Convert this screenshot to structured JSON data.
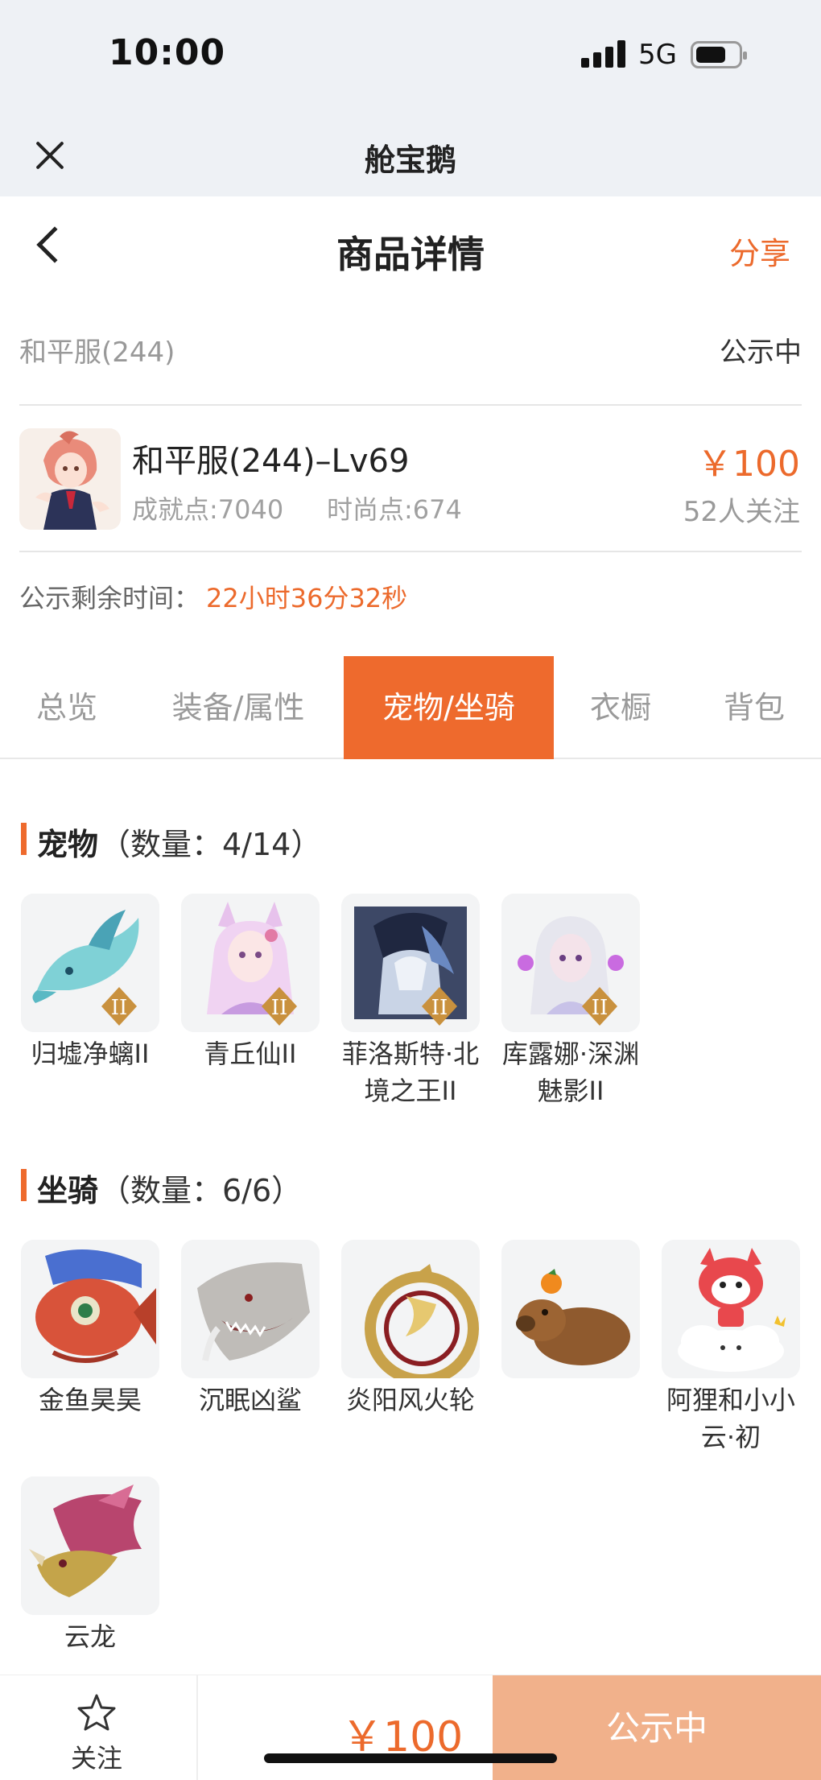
{
  "status_bar": {
    "time": "10:00",
    "network": "5G"
  },
  "mini_app": {
    "title": "舱宝鹅"
  },
  "nav": {
    "title": "商品详情",
    "share": "分享"
  },
  "server": {
    "name": "和平服(244)",
    "status": "公示中"
  },
  "item": {
    "title": "和平服(244)–Lv69",
    "achievement": "成就点:7040",
    "fashion": "时尚点:674",
    "price": "￥100",
    "followers": "52人关注"
  },
  "remaining": {
    "label": "公示剩余时间：",
    "value": "22小时36分32秒"
  },
  "tabs": [
    {
      "label": "总览"
    },
    {
      "label": "装备/属性"
    },
    {
      "label": "宠物/坐骑"
    },
    {
      "label": "衣橱"
    },
    {
      "label": "背包"
    }
  ],
  "active_tab": "宠物/坐骑",
  "pets": {
    "title": "宠物",
    "count": "（数量：4/14）",
    "items": [
      {
        "name": "归墟净螭II",
        "badge": "II",
        "icon": "water-dragon-pet"
      },
      {
        "name": "青丘仙II",
        "badge": "II",
        "icon": "fox-fairy-pet"
      },
      {
        "name": "菲洛斯特·北境之王II",
        "badge": "II",
        "icon": "dark-knight-pet"
      },
      {
        "name": "库露娜·深渊魅影II",
        "badge": "II",
        "icon": "white-haired-girl-pet"
      }
    ]
  },
  "mounts": {
    "title": "坐骑",
    "count": "（数量：6/6）",
    "items": [
      {
        "name": "金鱼昊昊",
        "icon": "goldfish-mount"
      },
      {
        "name": "沉眠凶鲨",
        "icon": "shark-mount"
      },
      {
        "name": "炎阳风火轮",
        "icon": "fire-wheel-mount"
      },
      {
        "name": "",
        "icon": "capybara-mount"
      },
      {
        "name": "阿狸和小小云·初",
        "icon": "ali-fox-cloud-mount"
      },
      {
        "name": "云龙",
        "icon": "cloud-dragon-mount"
      }
    ]
  },
  "bottom_bar": {
    "follow": "关注",
    "price": "￥100",
    "cta": "公示中"
  },
  "colors": {
    "accent": "#ee6a2d",
    "cta_disabled": "#f1b18b",
    "status_bg": "#eef1f5"
  }
}
